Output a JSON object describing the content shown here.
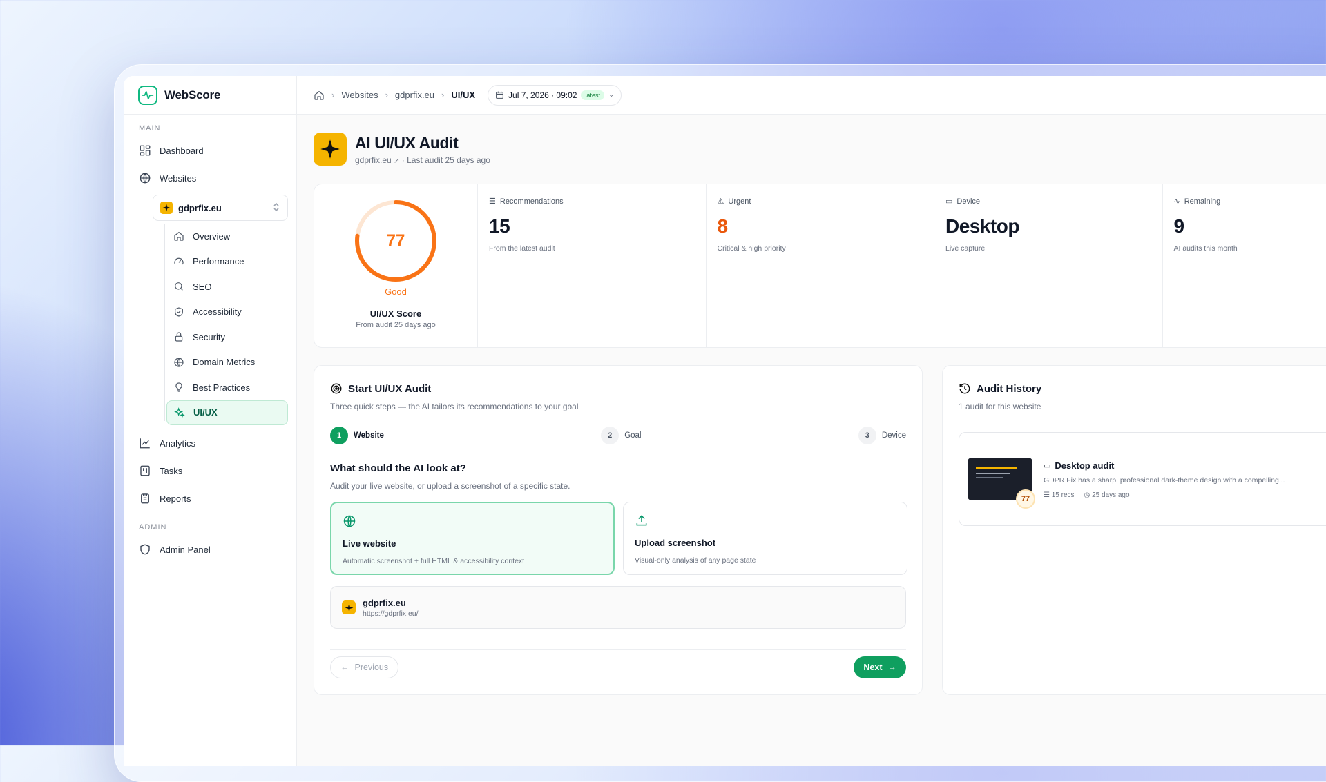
{
  "app": {
    "name": "WebScore"
  },
  "sidebar": {
    "section_main": "MAIN",
    "section_admin": "ADMIN",
    "dashboard": "Dashboard",
    "websites": "Websites",
    "site_selector": "gdprfix.eu",
    "sub_items": [
      "Overview",
      "Performance",
      "SEO",
      "Accessibility",
      "Security",
      "Domain Metrics",
      "Best Practices",
      "UI/UX"
    ],
    "analytics": "Analytics",
    "tasks": "Tasks",
    "reports": "Reports",
    "admin_panel": "Admin Panel"
  },
  "breadcrumb": {
    "websites": "Websites",
    "site": "gdprfix.eu",
    "current": "UI/UX"
  },
  "date_picker": {
    "value": "Jul 7, 2026 · 09:02",
    "badge": "latest"
  },
  "page": {
    "title": "AI UI/UX Audit",
    "site": "gdprfix.eu",
    "last_audit": "· Last audit 25 days ago"
  },
  "score": {
    "value": "77",
    "fraction": 0.77,
    "rating": "Good",
    "label": "UI/UX Score",
    "sub": "From audit 25 days ago"
  },
  "stats": [
    {
      "label": "Recommendations",
      "value": "15",
      "desc": "From the latest audit",
      "color": "#111827"
    },
    {
      "label": "Urgent",
      "value": "8",
      "desc": "Critical & high priority",
      "color": "#ea580c"
    },
    {
      "label": "Device",
      "value": "Desktop",
      "desc": "Live capture",
      "color": "#111827"
    },
    {
      "label": "Remaining",
      "value": "9",
      "desc": "AI audits this month",
      "color": "#111827"
    }
  ],
  "start": {
    "title": "Start UI/UX Audit",
    "subtitle": "Three quick steps — the AI tailors its recommendations to your goal",
    "steps": [
      {
        "n": "1",
        "label": "Website"
      },
      {
        "n": "2",
        "label": "Goal"
      },
      {
        "n": "3",
        "label": "Device"
      }
    ],
    "question": "What should the AI look at?",
    "question_sub": "Audit your live website, or upload a screenshot of a specific state.",
    "option_live_title": "Live website",
    "option_live_desc": "Automatic screenshot + full HTML & accessibility context",
    "option_upload_title": "Upload screenshot",
    "option_upload_desc": "Visual-only analysis of any page state",
    "site_name": "gdprfix.eu",
    "site_url": "https://gdprfix.eu/",
    "prev": "Previous",
    "next": "Next"
  },
  "history": {
    "title": "Audit History",
    "subtitle": "1 audit for this website",
    "item_title": "Desktop audit",
    "item_desc": "GDPR Fix has a sharp, professional dark-theme design with a compelling...",
    "item_recs": "15 recs",
    "item_time": "25 days ago",
    "item_score": "77"
  },
  "colors": {
    "accent": "#0f9f5f",
    "score": "#f97316",
    "brand_badge": "#f5b400"
  }
}
